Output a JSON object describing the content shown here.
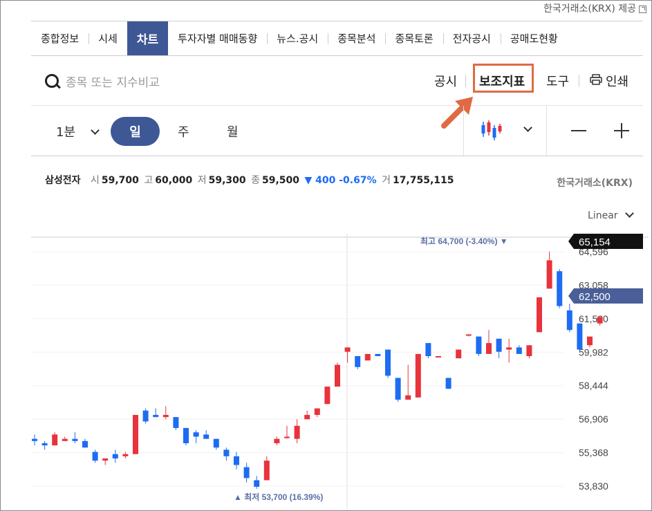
{
  "provider": {
    "label": "한국거래소(KRX) 제공"
  },
  "tabs": [
    {
      "label": "종합정보"
    },
    {
      "label": "시세"
    },
    {
      "label": "차트",
      "active": true
    },
    {
      "label": "투자자별 매매동향"
    },
    {
      "label": "뉴스.공시"
    },
    {
      "label": "종목분석"
    },
    {
      "label": "종목토론"
    },
    {
      "label": "전자공시"
    },
    {
      "label": "공매도현황"
    }
  ],
  "toolbar": {
    "search_placeholder": "종목 또는 지수비교",
    "notice": "공시",
    "indicator": "보조지표",
    "tools": "도구",
    "print": "인쇄"
  },
  "period": {
    "minute": "1분",
    "day": "일",
    "week": "주",
    "month": "월"
  },
  "stock": {
    "name": "삼성전자",
    "open_label": "시",
    "open": "59,700",
    "high_label": "고",
    "high": "60,000",
    "low_label": "저",
    "low": "59,300",
    "close_label": "종",
    "close": "59,500",
    "change": "▼ 400 -0.67%",
    "volume_label": "거",
    "volume": "17,755,115"
  },
  "exchange": "한국거래소(KRX)",
  "scale": "Linear",
  "chart_data": {
    "type": "candlestick",
    "y_ticks": [
      "64,596",
      "63,058",
      "61,520",
      "59,982",
      "58,444",
      "56,906",
      "55,368",
      "53,830"
    ],
    "y_tick_values": [
      64596,
      63058,
      61520,
      59982,
      58444,
      56906,
      55368,
      53830
    ],
    "badges": {
      "top": "65,154",
      "current": "62,500"
    },
    "annotations": {
      "max": "최고 64,700 (-3.40%)",
      "min": "최저 53,700 (16.39%)"
    },
    "up_color": "#e8333c",
    "down_color": "#1d6cf2",
    "candles": [
      [
        56000,
        56200,
        55700,
        55900
      ],
      [
        55800,
        55900,
        55500,
        55700
      ],
      [
        55700,
        56300,
        55700,
        56200
      ],
      [
        55900,
        56100,
        55900,
        56000
      ],
      [
        56000,
        56300,
        55800,
        55900
      ],
      [
        55900,
        56000,
        55700,
        55600
      ],
      [
        55400,
        55500,
        54900,
        55000
      ],
      [
        55000,
        55100,
        54800,
        55100
      ],
      [
        55300,
        55500,
        54900,
        55100
      ],
      [
        55200,
        55400,
        55100,
        55300
      ],
      [
        55300,
        57100,
        55300,
        57100
      ],
      [
        57300,
        57400,
        56700,
        56800
      ],
      [
        57100,
        57400,
        57000,
        57000
      ],
      [
        57000,
        57500,
        56900,
        57100
      ],
      [
        57000,
        57000,
        56400,
        56500
      ],
      [
        56500,
        56500,
        55700,
        55800
      ],
      [
        56300,
        56400,
        55800,
        56100
      ],
      [
        56200,
        56400,
        56000,
        56000
      ],
      [
        56000,
        56000,
        55500,
        55600
      ],
      [
        55500,
        55600,
        55000,
        55200
      ],
      [
        55200,
        55400,
        54600,
        54800
      ],
      [
        54700,
        54900,
        54000,
        54200
      ],
      [
        54100,
        54300,
        53700,
        53800
      ],
      [
        54100,
        55200,
        54100,
        55000
      ],
      [
        55800,
        56100,
        55700,
        56000
      ],
      [
        56100,
        56600,
        56000,
        56100
      ],
      [
        56000,
        56900,
        55800,
        56600
      ],
      [
        56900,
        57300,
        56900,
        57100
      ],
      [
        57100,
        57400,
        57000,
        57400
      ],
      [
        57600,
        58000,
        57600,
        58400
      ],
      [
        58400,
        59500,
        58400,
        59400
      ],
      [
        60000,
        60100,
        59500,
        60200
      ],
      [
        59800,
        59800,
        59200,
        59300
      ],
      [
        59600,
        59800,
        59700,
        59900
      ],
      [
        59900,
        59900,
        59800,
        59800
      ],
      [
        60100,
        60100,
        58800,
        58900
      ],
      [
        58800,
        58800,
        57700,
        57800
      ],
      [
        57800,
        59400,
        57800,
        58000
      ],
      [
        57900,
        59900,
        57900,
        59900
      ],
      [
        60400,
        60400,
        59700,
        59800
      ],
      [
        59800,
        59800,
        59800,
        59800
      ],
      [
        58800,
        58800,
        58300,
        58300
      ],
      [
        59700,
        60100,
        59700,
        60100
      ],
      [
        60800,
        60800,
        60700,
        60800
      ],
      [
        60700,
        60700,
        59800,
        59900
      ],
      [
        59900,
        61000,
        59900,
        60400
      ],
      [
        60600,
        60600,
        59700,
        60000
      ],
      [
        60100,
        60600,
        59500,
        60200
      ],
      [
        60200,
        60300,
        59900,
        59900
      ],
      [
        59800,
        60200,
        59700,
        60300
      ],
      [
        60900,
        62300,
        60900,
        62500
      ],
      [
        62900,
        64600,
        62900,
        64200
      ],
      [
        63700,
        63800,
        62000,
        62100
      ],
      [
        61900,
        62200,
        60900,
        61000
      ],
      [
        61300,
        61300,
        60400,
        60100
      ],
      [
        60300,
        60400,
        60200,
        60700
      ],
      [
        61300,
        61300,
        61200,
        61600
      ]
    ]
  }
}
